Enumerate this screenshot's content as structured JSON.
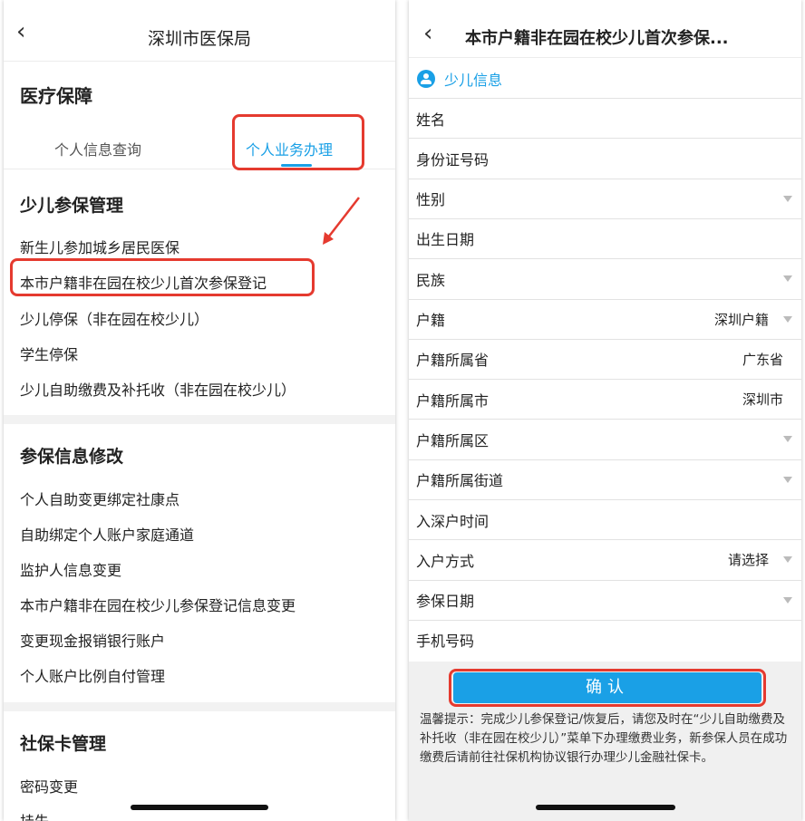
{
  "left": {
    "nav_back": "‹",
    "nav_title": "深圳市医保局",
    "section_title": "医疗保障",
    "tabs": [
      "个人信息查询",
      "个人业务办理"
    ],
    "groups": [
      {
        "title": "少儿参保管理",
        "items": [
          "新生儿参加城乡居民医保",
          "本市户籍非在园在校少儿首次参保登记",
          "少儿停保（非在园在校少儿）",
          "学生停保",
          "少儿自助缴费及补托收（非在园在校少儿）"
        ]
      },
      {
        "title": "参保信息修改",
        "items": [
          "个人自助变更绑定社康点",
          "自助绑定个人账户家庭通道",
          "监护人信息变更",
          "本市户籍非在园在校少儿参保登记信息变更",
          "变更现金报销银行账户",
          "个人账户比例自付管理"
        ]
      },
      {
        "title": "社保卡管理",
        "items": [
          "密码变更",
          "挂失"
        ]
      }
    ]
  },
  "right": {
    "nav_back": "‹",
    "nav_title": "本市户籍非在园在校少儿首次参保...",
    "info_label": "少儿信息",
    "fields": [
      {
        "label": "姓名",
        "value": "",
        "dropdown": false
      },
      {
        "label": "身份证号码",
        "value": "",
        "dropdown": false
      },
      {
        "label": "性别",
        "value": "",
        "dropdown": true
      },
      {
        "label": "出生日期",
        "value": "",
        "dropdown": false
      },
      {
        "label": "民族",
        "value": "",
        "dropdown": true
      },
      {
        "label": "户籍",
        "value": "深圳户籍",
        "dropdown": true
      },
      {
        "label": "户籍所属省",
        "value": "广东省",
        "dropdown": false
      },
      {
        "label": "户籍所属市",
        "value": "深圳市",
        "dropdown": false
      },
      {
        "label": "户籍所属区",
        "value": "",
        "dropdown": true
      },
      {
        "label": "户籍所属街道",
        "value": "",
        "dropdown": true
      },
      {
        "label": "入深户时间",
        "value": "",
        "dropdown": false
      },
      {
        "label": "入户方式",
        "value": "请选择",
        "dropdown": true
      },
      {
        "label": "参保日期",
        "value": "",
        "dropdown": true
      },
      {
        "label": "手机号码",
        "value": "",
        "dropdown": false
      }
    ],
    "confirm_label": "确认",
    "notice": "温馨提示：完成少儿参保登记/恢复后，请您及时在“少儿自助缴费及补托收（非在园在校少儿）”菜单下办理缴费业务，新参保人员在成功缴费后请前往社保机构协议银行办理少儿金融社保卡。"
  },
  "colors": {
    "accent": "#1aa0e6",
    "highlight": "#e53a2f"
  }
}
